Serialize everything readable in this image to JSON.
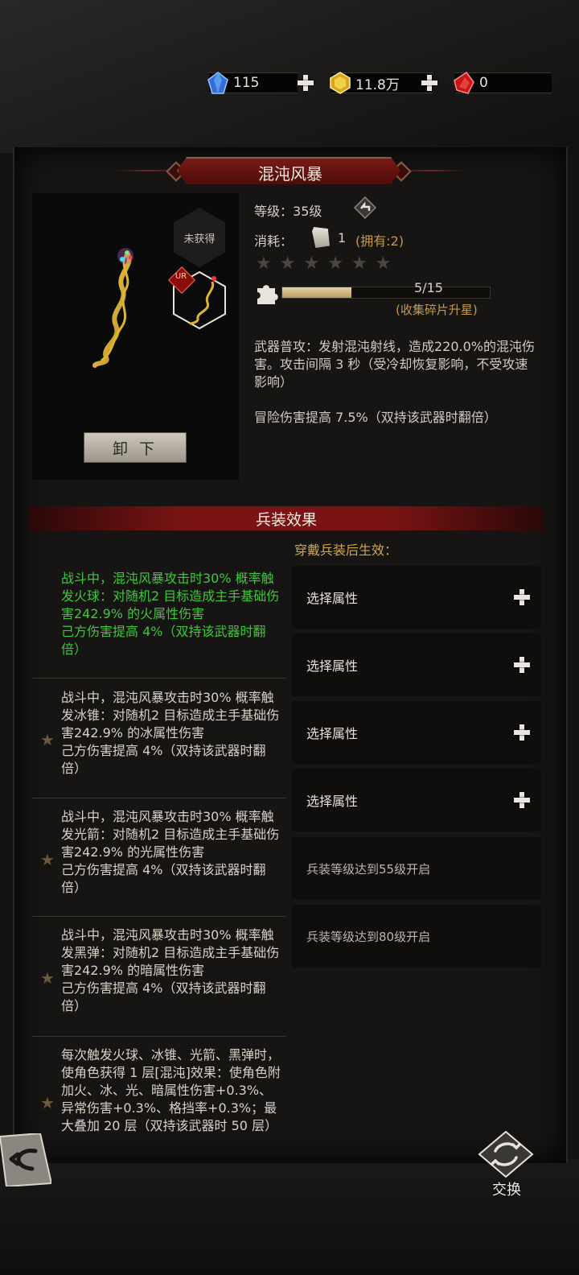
{
  "currency": {
    "diamonds": "115",
    "gold": "11.8万",
    "rubies": "0"
  },
  "weapon": {
    "name": "混沌风暴",
    "unowned_badge": "未获得",
    "rarity_badge": "UR",
    "unload_label": "卸下",
    "level_label": "等级：",
    "level_value": "35级",
    "cost_label": "消耗：",
    "cost_value": "1",
    "owned_text": "(拥有:2)",
    "star_count": 6,
    "stars_filled": 0,
    "fragments": "5/15",
    "fragments_progress": 0.333,
    "fragments_hint": "(收集碎片升星)",
    "attack_desc": "武器普攻：发射混沌射线，造成220.0%的混沌伤害。攻击间隔 3 秒（受冷却恢复影响，不受攻速影响）",
    "adventure_bonus": "冒险伤害提高 7.5%（双持该武器时翻倍）"
  },
  "effects": {
    "header": "兵装效果",
    "wear_hint": "穿戴兵装后生效：",
    "list": [
      {
        "text": "战斗中，混沌风暴攻击时30% 概率触发火球：对随机2 目标造成主手基础伤害242.9% 的火属性伤害\n己方伤害提高 4%（双持该武器时翻倍）",
        "active": true
      },
      {
        "text": "战斗中，混沌风暴攻击时30% 概率触发冰锥：对随机2 目标造成主手基础伤害242.9% 的冰属性伤害\n己方伤害提高 4%（双持该武器时翻倍）",
        "active": false
      },
      {
        "text": "战斗中，混沌风暴攻击时30% 概率触发光箭：对随机2 目标造成主手基础伤害242.9% 的光属性伤害\n己方伤害提高 4%（双持该武器时翻倍）",
        "active": false
      },
      {
        "text": "战斗中，混沌风暴攻击时30% 概率触发黑弹：对随机2 目标造成主手基础伤害242.9% 的暗属性伤害\n己方伤害提高 4%（双持该武器时翻倍）",
        "active": false
      },
      {
        "text": "每次触发火球、冰锥、光箭、黑弹时，使角色获得 1 层[混沌]效果：使角色附加火、冰、光、暗属性伤害+0.3%、异常伤害+0.3%、格挡率+0.3%；最大叠加 20 层（双持该武器时 50 层）",
        "active": false
      }
    ],
    "slots": [
      {
        "label": "选择属性",
        "locked": false
      },
      {
        "label": "选择属性",
        "locked": false
      },
      {
        "label": "选择属性",
        "locked": false
      },
      {
        "label": "选择属性",
        "locked": false
      },
      {
        "label": "兵装等级达到55级开启",
        "locked": true
      },
      {
        "label": "兵装等级达到80级开启",
        "locked": true
      }
    ]
  },
  "bottom": {
    "swap_label": "交换"
  },
  "colors": {
    "active_effect": "#3ec83a",
    "accent_gold": "#cfa64e",
    "header_red": "#7a1414"
  },
  "icons": [
    "diamond-icon",
    "gold-icon",
    "ruby-icon",
    "plus-icon",
    "level-up-arrow-icon",
    "scroll-icon",
    "star-icon",
    "puzzle-piece-icon",
    "back-arrow-icon",
    "swap-icon",
    "chaos-staff-image"
  ]
}
